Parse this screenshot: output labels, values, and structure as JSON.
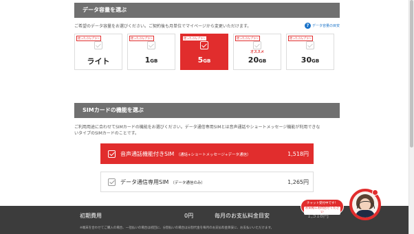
{
  "data_section": {
    "header": "データ容量を選ぶ",
    "description": "ご希望のデータ容量をお選びください。ご契約後も月単位でマイページから変更いただけます。",
    "help_link": "データ容量の目安",
    "badge": "使ったぶんプラン",
    "recommend": "オススメ",
    "plans": [
      {
        "label": "ライト",
        "unit": ""
      },
      {
        "label": "1",
        "unit": "GB"
      },
      {
        "label": "5",
        "unit": "GB"
      },
      {
        "label": "20",
        "unit": "GB"
      },
      {
        "label": "30",
        "unit": "GB"
      }
    ],
    "selected_index": 2
  },
  "sim_section": {
    "header": "SIMカードの機能を選ぶ",
    "description_line1": "ご利用用途に合わせてSIMカードの機能をお選びください。データ通信専用SIMとは音声通話やショートメッセージ機能が利用できな",
    "description_line2": "いタイプのSIMカードのことです。",
    "options": [
      {
        "name": "音声通話機能付きSIM",
        "note": "（通話+ショートメッセージ+データ通信）",
        "price": "1,518円"
      },
      {
        "name": "データ通信専用SIM",
        "note": "（データ通信のみ）",
        "price": "1,265円"
      }
    ]
  },
  "footer": {
    "initial_cost_label": "初期費用",
    "initial_cost_value": "0円",
    "monthly_label": "毎月のお支払料金目安",
    "monthly_value": "1,518円",
    "note": "※端末を合わせてご購入の場合、一括払いの場合は初回に、分割払いの場合は分割代金を毎月のお支払料金目安に、お支払いいただけます。"
  },
  "chat": {
    "line1": "チャット受付中です！",
    "line2": "お気軽にお問合せください"
  },
  "colors": {
    "accent": "#e12d2d",
    "header_bg": "#707070",
    "footer_bg": "#3c3c3c"
  }
}
